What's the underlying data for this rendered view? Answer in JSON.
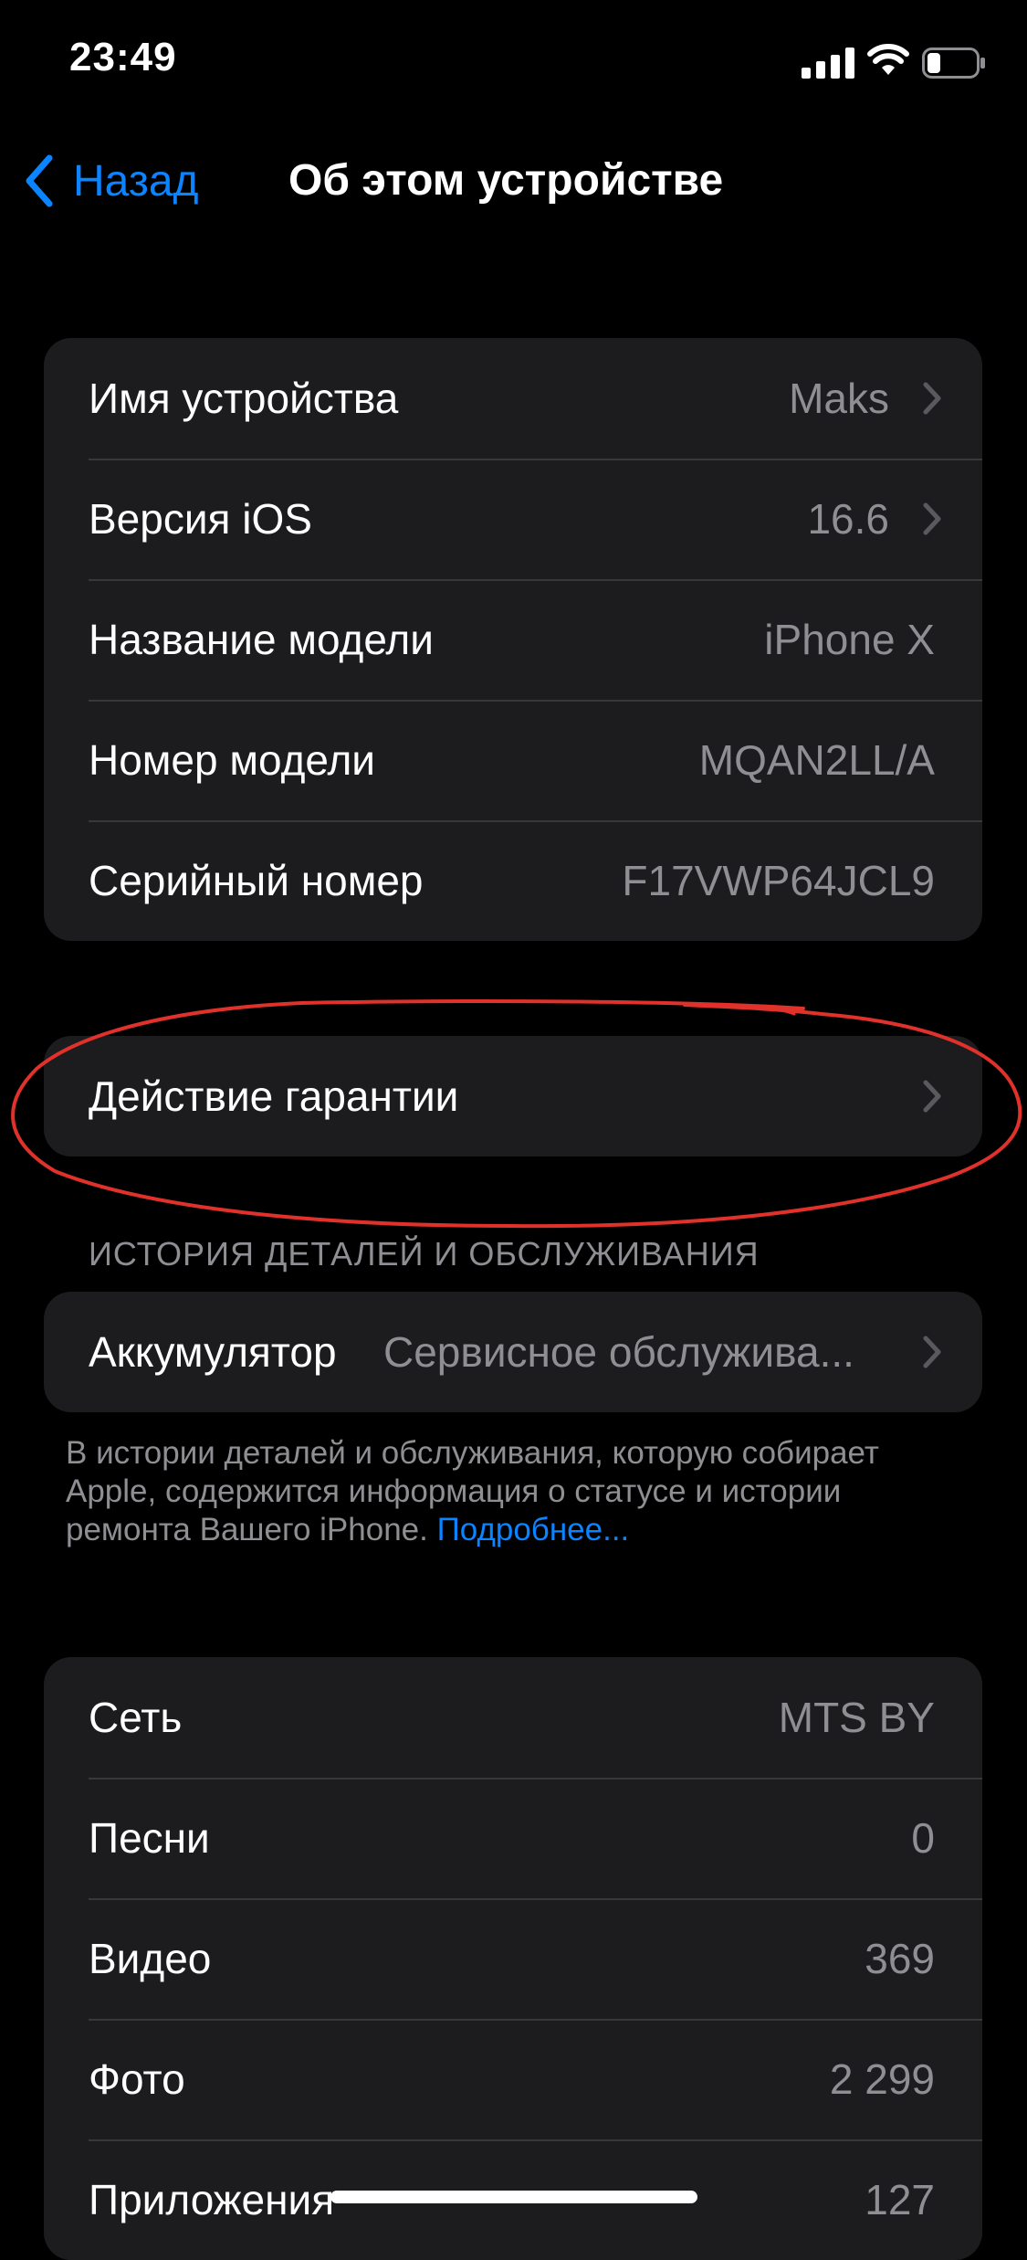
{
  "status_bar": {
    "time": "23:49",
    "icons": [
      "signal-icon",
      "wifi-icon",
      "battery-icon"
    ]
  },
  "nav": {
    "back_label": "Назад",
    "title": "Об этом устройстве"
  },
  "info_group": [
    {
      "label": "Имя устройства",
      "value": "Maks",
      "chevron": true
    },
    {
      "label": "Версия iOS",
      "value": "16.6",
      "chevron": true
    },
    {
      "label": "Название модели",
      "value": "iPhone X",
      "chevron": false
    },
    {
      "label": "Номер модели",
      "value": "MQAN2LL/A",
      "chevron": false
    },
    {
      "label": "Серийный номер",
      "value": "F17VWP64JCL9",
      "chevron": false
    }
  ],
  "warranty": {
    "label": "Действие гарантии"
  },
  "service_history": {
    "header": "ИСТОРИЯ ДЕТАЛЕЙ И ОБСЛУЖИВАНИЯ",
    "battery_label": "Аккумулятор",
    "battery_value": "Сервисное обслужива...",
    "footnote": "В истории деталей и обслуживания, которую собирает Apple, содержится информация о статусе и истории ремонта Вашего iPhone. ",
    "footnote_link": "Подробнее..."
  },
  "stats_group": [
    {
      "label": "Сеть",
      "value": "MTS BY"
    },
    {
      "label": "Песни",
      "value": "0"
    },
    {
      "label": "Видео",
      "value": "369"
    },
    {
      "label": "Фото",
      "value": "2 299"
    },
    {
      "label": "Приложения",
      "value": "127"
    }
  ],
  "colors": {
    "accent": "#0a84ff",
    "background": "#000000",
    "cell": "#1c1c1e",
    "secondary_text": "#8e8e93",
    "annotation": "#e0312b"
  }
}
